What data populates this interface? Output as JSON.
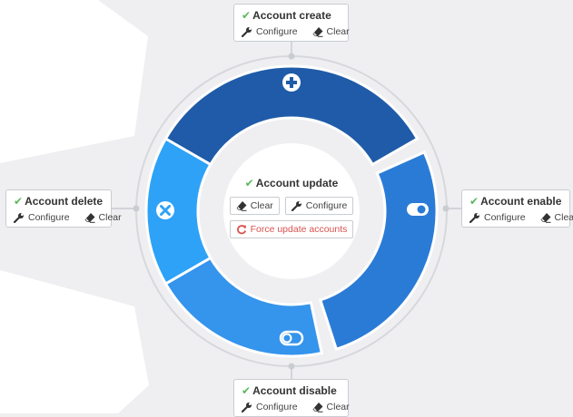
{
  "nodes": {
    "create": {
      "title": "Account create",
      "configure": "Configure",
      "clear": "Clear"
    },
    "delete": {
      "title": "Account delete",
      "configure": "Configure",
      "clear": "Clear"
    },
    "enable": {
      "title": "Account enable",
      "configure": "Configure",
      "clear": "Clear"
    },
    "disable": {
      "title": "Account disable",
      "configure": "Configure",
      "clear": "Clear"
    }
  },
  "center": {
    "title": "Account update",
    "clear": "Clear",
    "configure": "Configure",
    "force_update": "Force update accounts"
  },
  "ring_icons": [
    "plus-icon",
    "toggle-on-icon",
    "toggle-off-icon",
    "times-icon"
  ],
  "colors": {
    "segment_top": "#1f5ba8",
    "segment_right": "#2a7bd6",
    "segment_bottom": "#3594ec",
    "segment_left": "#2ea2f7",
    "success": "#5cb85c",
    "danger": "#d9534f"
  }
}
